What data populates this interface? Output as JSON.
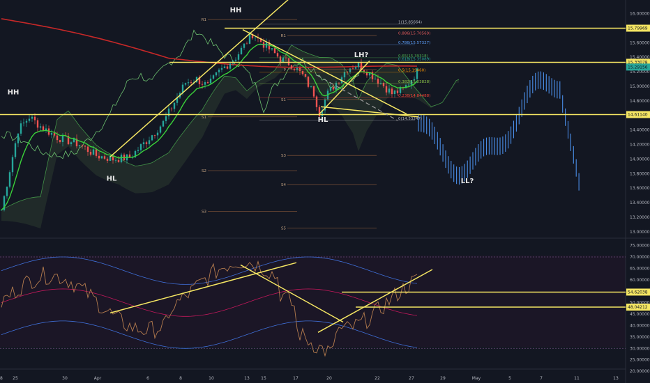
{
  "chart_data": [
    {
      "type": "candlestick",
      "panel": "price",
      "x_ticks": [
        "25",
        "30",
        "Apr",
        "6",
        "8",
        "10",
        "13",
        "15",
        "17",
        "20",
        "22",
        "27",
        "29",
        "May",
        "5",
        "7",
        "11",
        "13",
        "18"
      ],
      "y_ticks": [
        "16.00000",
        "15.80000",
        "15.60000",
        "15.40000",
        "15.20000",
        "15.00000",
        "14.80000",
        "14.60000",
        "14.40000",
        "14.20000",
        "14.00000",
        "13.80000",
        "13.60000",
        "13.40000",
        "13.20000",
        "13.00000"
      ],
      "ylim": [
        12.95,
        16.13
      ],
      "price_tags": [
        {
          "value": "15.79969",
          "level": 15.79969,
          "color": "#f5e663"
        },
        {
          "value": "15.33078",
          "level": 15.33078,
          "color": "#f5e663"
        },
        {
          "value": "15.29156",
          "level": 15.265,
          "color": "#26a69a"
        },
        {
          "value": "14.61140",
          "level": 14.6114,
          "color": "#f5e663"
        }
      ],
      "fib_labels": [
        {
          "text": "1(15.85664)",
          "level": 15.85664,
          "color": "#b2b5be"
        },
        {
          "text": "0.786(15.57327)",
          "level": 15.57327,
          "color": "#5b9cf6"
        },
        {
          "text": "0.65(15.39318)",
          "level": 15.39318,
          "color": "#4caf50"
        },
        {
          "text": "0.618(15.35089)",
          "level": 15.35089,
          "color": "#26a69a"
        },
        {
          "text": "0.5(15.19460)",
          "level": 15.1946,
          "color": "#ff9800"
        },
        {
          "text": "0.382(15.03828)",
          "level": 15.03828,
          "color": "#8bc34a"
        },
        {
          "text": "0.236(14.84488)",
          "level": 14.84488,
          "color": "#f44336"
        },
        {
          "text": "0(14.53247)",
          "level": 14.53247,
          "color": "#b2b5be"
        }
      ],
      "fib_extension": {
        "text": "0.886(15.70569)",
        "level": 15.70569,
        "color": "#e05a5a"
      },
      "pivot_labels": [
        {
          "text": "R1",
          "level": 15.92
        },
        {
          "text": "R1",
          "level": 15.7
        },
        {
          "text": "P",
          "level": 15.23
        },
        {
          "text": "S1",
          "level": 14.82
        },
        {
          "text": "S1",
          "level": 14.58
        },
        {
          "text": "S2",
          "level": 13.84
        },
        {
          "text": "S3",
          "level": 13.28
        },
        {
          "text": "S3",
          "level": 14.05
        },
        {
          "text": "S4",
          "level": 13.65
        },
        {
          "text": "S5",
          "level": 13.05
        }
      ],
      "annotations": [
        {
          "text": "HH",
          "x": "10",
          "y": 16.02
        },
        {
          "text": "HH",
          "x": "25",
          "y": 14.89
        },
        {
          "text": "HL",
          "x": "30",
          "y": 13.7
        },
        {
          "text": "LH?",
          "x": "22",
          "y": 15.4
        },
        {
          "text": "HL",
          "x": "20",
          "y": 14.51
        },
        {
          "text": "LL?",
          "x": "5",
          "y": 13.67
        }
      ]
    },
    {
      "type": "line",
      "panel": "indicator",
      "y_ticks": [
        "75.00000",
        "70.00000",
        "65.00000",
        "60.00000",
        "55.00000",
        "50.00000",
        "45.00000",
        "40.00000",
        "35.00000",
        "30.00000",
        "25.00000",
        "20.00000"
      ],
      "ylim": [
        18.5,
        77
      ],
      "bands": [
        30,
        70
      ],
      "value_tags": [
        {
          "value": "54.62038",
          "level": 54.62038,
          "color": "#f5e663"
        },
        {
          "value": "48.04212",
          "level": 48.04212,
          "color": "#f5e663"
        }
      ]
    }
  ]
}
